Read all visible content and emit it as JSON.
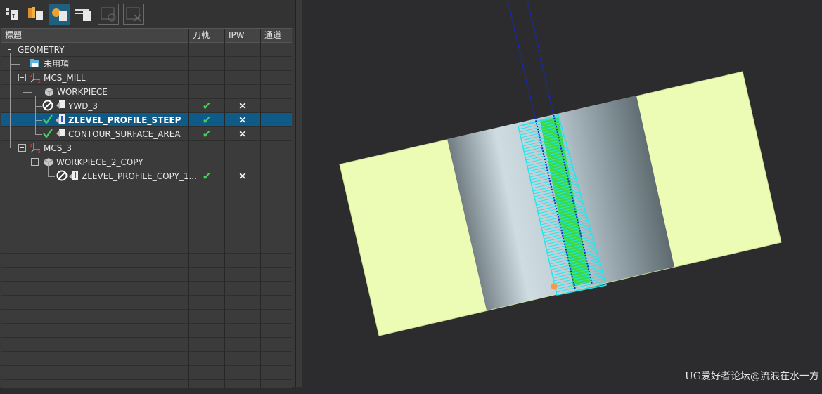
{
  "toolbar": {
    "buttons": [
      {
        "name": "program-order-view",
        "icon": "program-order-view-icon"
      },
      {
        "name": "machine-tool-view",
        "icon": "machine-tool-view-icon"
      },
      {
        "name": "geometry-view",
        "icon": "geometry-view-icon",
        "active": true
      },
      {
        "name": "machining-method-view",
        "icon": "machining-method-view-icon"
      },
      {
        "name": "create-object",
        "icon": "create-object-icon",
        "disabled": true
      },
      {
        "name": "delete-object",
        "icon": "delete-object-icon",
        "disabled": true
      }
    ]
  },
  "navigator": {
    "columns": {
      "name": "標題",
      "toolpath": "刀軌",
      "ipw": "IPW",
      "channel": "通道"
    },
    "rows": [
      {
        "label": "GEOMETRY",
        "toolpath": "",
        "ipw": ""
      },
      {
        "label": "未用項",
        "toolpath": "",
        "ipw": ""
      },
      {
        "label": "MCS_MILL",
        "toolpath": "",
        "ipw": ""
      },
      {
        "label": "WORKPIECE",
        "toolpath": "",
        "ipw": ""
      },
      {
        "label": "YWD_3",
        "toolpath": "✔",
        "ipw": "✕"
      },
      {
        "label": "ZLEVEL_PROFILE_STEEP",
        "toolpath": "✔",
        "ipw": "✕"
      },
      {
        "label": "CONTOUR_SURFACE_AREA",
        "toolpath": "✔",
        "ipw": "✕"
      },
      {
        "label": "MCS_3",
        "toolpath": "",
        "ipw": ""
      },
      {
        "label": "WORKPIECE_2_COPY",
        "toolpath": "",
        "ipw": ""
      },
      {
        "label": "ZLEVEL_PROFILE_COPY_1...",
        "toolpath": "✔",
        "ipw": "✕"
      }
    ]
  },
  "viewport": {
    "colors": {
      "background": "#2c2c2e",
      "stock": "#ecfcb4",
      "toolpath_cyan": "#22e6ee",
      "cut_area_green": "#3bd94a",
      "tool_axis_blue": "#1428c8",
      "origin_point": "#f09a4a"
    }
  },
  "watermark": "UG爱好者论坛@流浪在水一方"
}
